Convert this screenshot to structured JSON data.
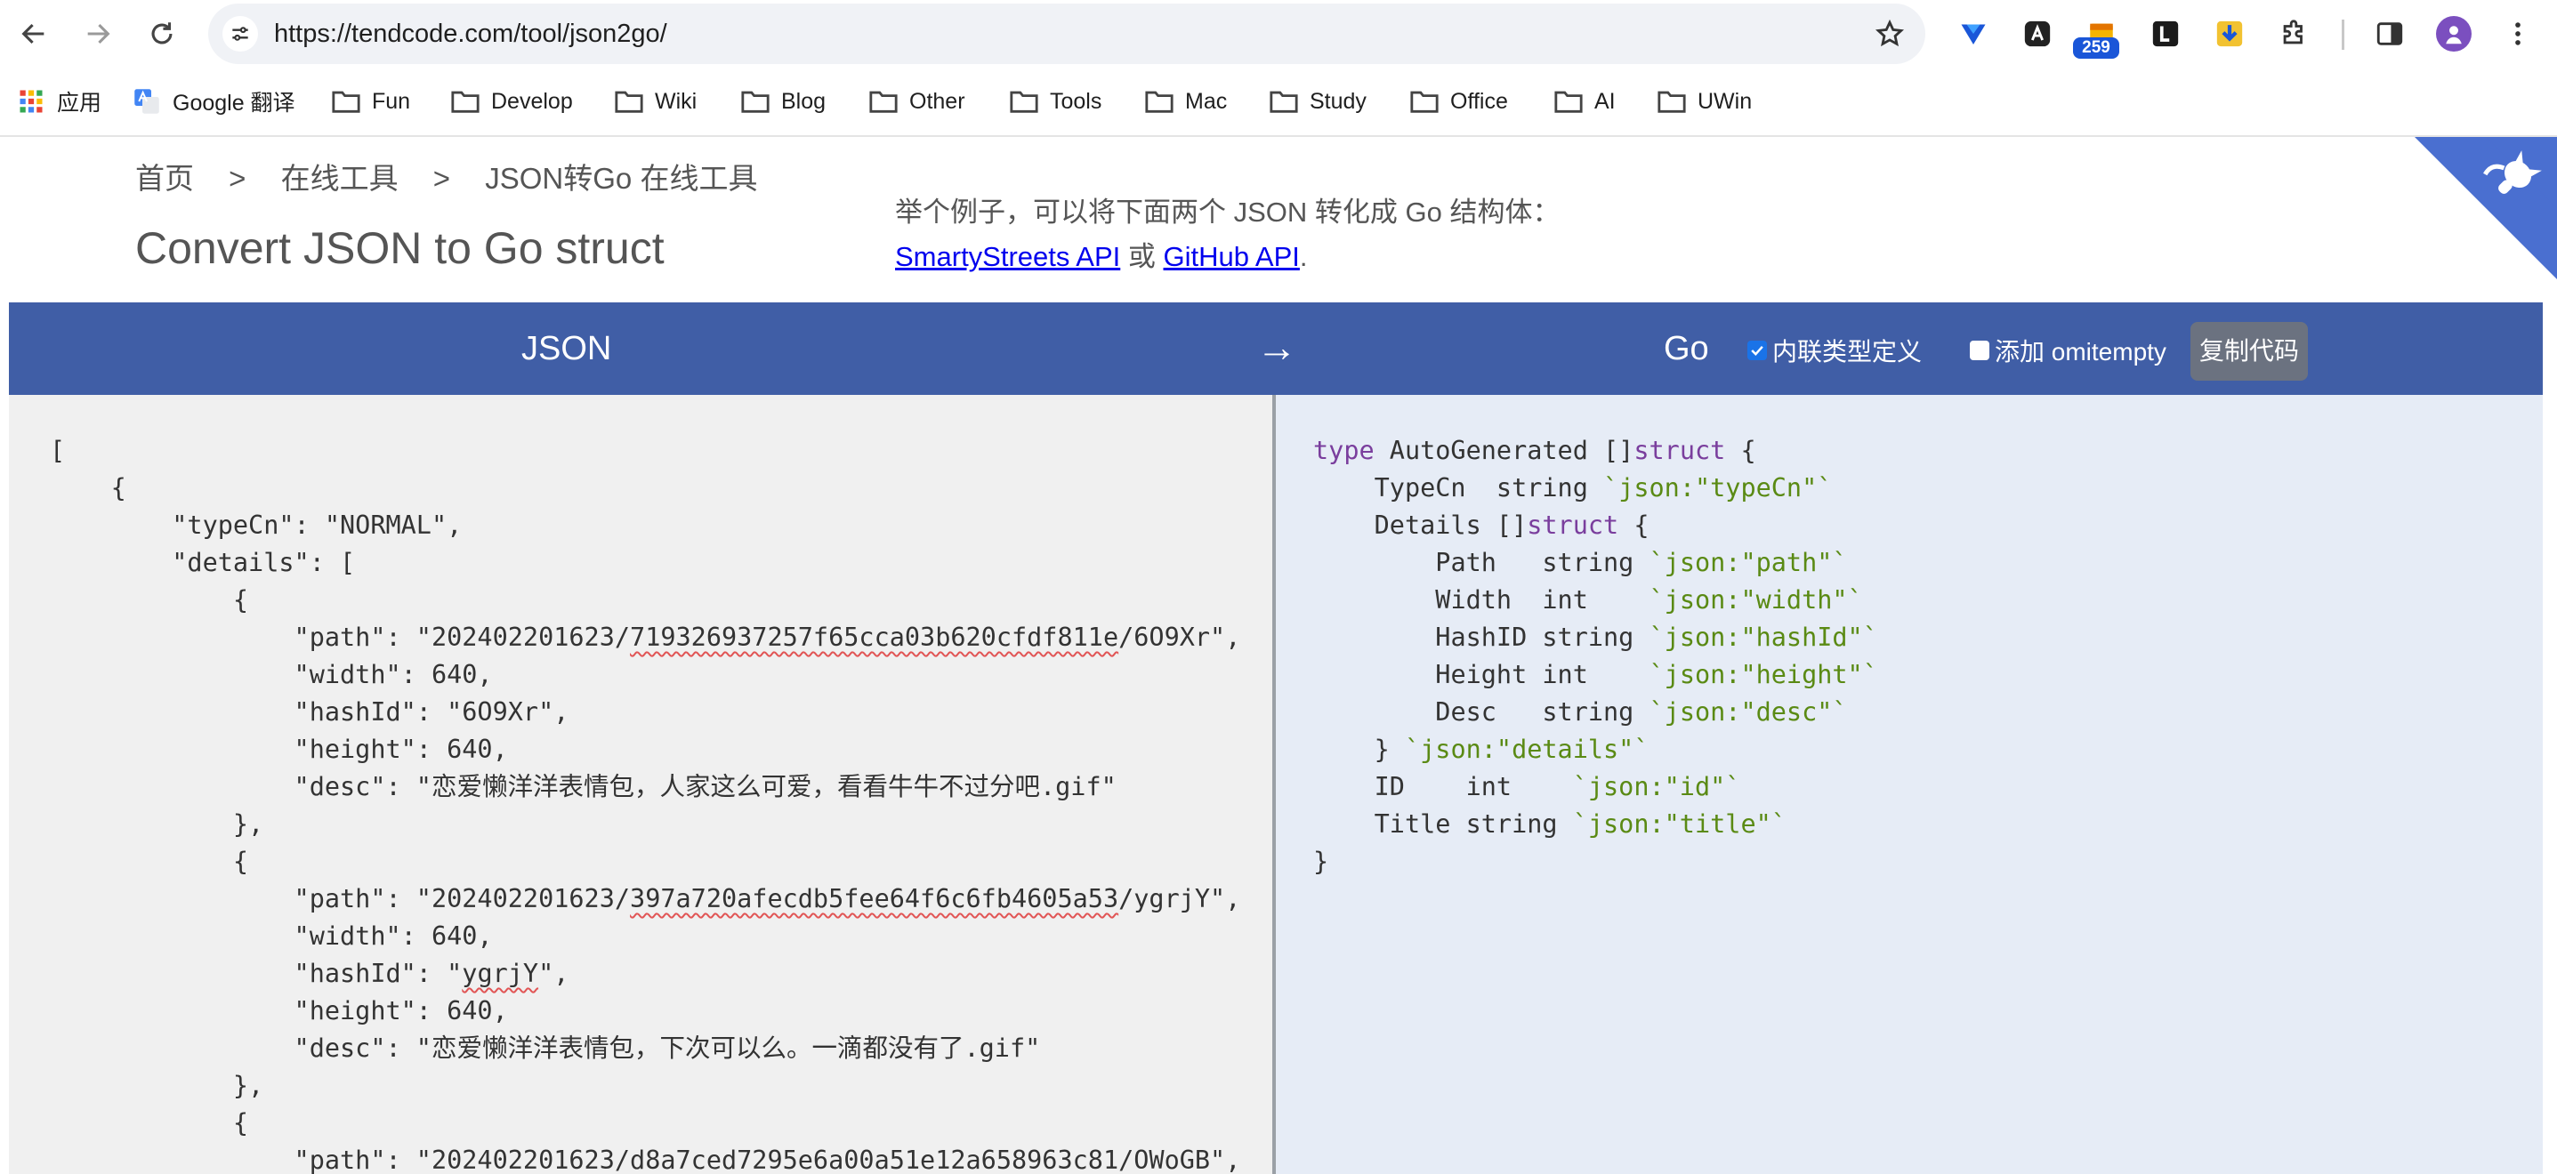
{
  "browser": {
    "url": "https://tendcode.com/tool/json2go/",
    "extension_badge": "259"
  },
  "bookmarks": [
    {
      "icon": "apps-grid-icon",
      "label": "应用"
    },
    {
      "icon": "google-translate-icon",
      "label": "Google 翻译"
    },
    {
      "icon": "folder-icon",
      "label": "Fun"
    },
    {
      "icon": "folder-icon",
      "label": "Develop"
    },
    {
      "icon": "folder-icon",
      "label": "Wiki"
    },
    {
      "icon": "folder-icon",
      "label": "Blog"
    },
    {
      "icon": "folder-icon",
      "label": "Other"
    },
    {
      "icon": "folder-icon",
      "label": "Tools"
    },
    {
      "icon": "folder-icon",
      "label": "Mac"
    },
    {
      "icon": "folder-icon",
      "label": "Study"
    },
    {
      "icon": "folder-icon",
      "label": "Office"
    },
    {
      "icon": "folder-icon",
      "label": "AI"
    },
    {
      "icon": "folder-icon",
      "label": "UWin"
    }
  ],
  "breadcrumb": {
    "home": "首页",
    "separator": ">",
    "tools": "在线工具",
    "current": "JSON转Go 在线工具"
  },
  "page_title": "Convert JSON to Go struct",
  "example": {
    "text": "举个例子，可以将下面两个 JSON 转化成 Go 结构体：",
    "link1": "SmartyStreets API",
    "or": "或",
    "link2": "GitHub API",
    "period": "."
  },
  "converter": {
    "left_label": "JSON",
    "arrow": "→",
    "right_label": "Go",
    "inline_types_label": "内联类型定义",
    "inline_types_checked": true,
    "omitempty_label": "添加 omitempty",
    "omitempty_checked": false,
    "copy_button": "复制代码"
  },
  "json_lines": [
    "[",
    "    {",
    "        \"typeCn\": \"NORMAL\",",
    "        \"details\": [",
    "            {",
    "                \"path\": \"202402201623/719326937257f65cca03b620cfdf811e/6O9Xr\",",
    "                \"width\": 640,",
    "                \"hashId\": \"6O9Xr\",",
    "                \"height\": 640,",
    "                \"desc\": \"恋爱懒洋洋表情包，人家这么可爱，看看牛牛不过分吧.gif\"",
    "            },",
    "            {",
    "                \"path\": \"202402201623/397a720afecdb5fee64f6c6fb4605a53/ygrjY\",",
    "                \"width\": 640,",
    "                \"hashId\": \"ygrjY\",",
    "                \"height\": 640,",
    "                \"desc\": \"恋爱懒洋洋表情包，下次可以么。一滴都没有了.gif\"",
    "            },",
    "            {",
    "                \"path\": \"202402201623/d8a7ced7295e6a00a51e12a658963c81/OWoGB\","
  ],
  "go_lines": [
    {
      "indent": "",
      "kw": "type",
      "text": " AutoGenerated []",
      "kw2": "struct",
      "text2": " {",
      "tag": ""
    },
    {
      "indent": "    ",
      "kw": "",
      "text": "TypeCn  string ",
      "kw2": "",
      "text2": "",
      "tag": "`json:\"typeCn\"`"
    },
    {
      "indent": "    ",
      "kw": "",
      "text": "Details []",
      "kw2": "struct",
      "text2": " {",
      "tag": ""
    },
    {
      "indent": "        ",
      "kw": "",
      "text": "Path   string ",
      "kw2": "",
      "text2": "",
      "tag": "`json:\"path\"`"
    },
    {
      "indent": "        ",
      "kw": "",
      "text": "Width  int    ",
      "kw2": "",
      "text2": "",
      "tag": "`json:\"width\"`"
    },
    {
      "indent": "        ",
      "kw": "",
      "text": "HashID string ",
      "kw2": "",
      "text2": "",
      "tag": "`json:\"hashId\"`"
    },
    {
      "indent": "        ",
      "kw": "",
      "text": "Height int    ",
      "kw2": "",
      "text2": "",
      "tag": "`json:\"height\"`"
    },
    {
      "indent": "        ",
      "kw": "",
      "text": "Desc   string ",
      "kw2": "",
      "text2": "",
      "tag": "`json:\"desc\"`"
    },
    {
      "indent": "    ",
      "kw": "",
      "text": "} ",
      "kw2": "",
      "text2": "",
      "tag": "`json:\"details\"`"
    },
    {
      "indent": "    ",
      "kw": "",
      "text": "ID    int    ",
      "kw2": "",
      "text2": "",
      "tag": "`json:\"id\"`"
    },
    {
      "indent": "    ",
      "kw": "",
      "text": "Title string ",
      "kw2": "",
      "text2": "",
      "tag": "`json:\"title\"`"
    },
    {
      "indent": "",
      "kw": "",
      "text": "}",
      "kw2": "",
      "text2": "",
      "tag": ""
    }
  ]
}
